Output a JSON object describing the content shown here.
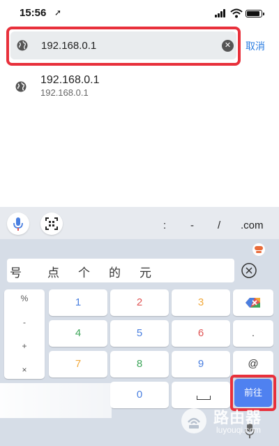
{
  "status": {
    "time": "15:56",
    "location_glyph": "➚"
  },
  "address_bar": {
    "url": "192.168.0.1",
    "cancel_label": "取消",
    "clear_glyph": "✕"
  },
  "suggestion": {
    "title": "192.168.0.1",
    "subtitle": "192.168.0.1"
  },
  "keyboard": {
    "quick_keys": [
      ":",
      "-",
      "/",
      ".com"
    ],
    "candidates": [
      "号",
      "点",
      "个",
      "的",
      "元"
    ],
    "symbols": [
      "%",
      "-",
      "+",
      "×"
    ],
    "rows": [
      [
        "1",
        "2",
        "3"
      ],
      [
        "4",
        "5",
        "6"
      ],
      [
        "7",
        "8",
        "9"
      ]
    ],
    "right_col": [
      "",
      ".",
      "@"
    ],
    "zero_key": "0",
    "go_label": "前往",
    "digit_colors": {
      "1": "#4a7fe0",
      "2": "#e05555",
      "3": "#f2a93b",
      "4": "#3ea65a",
      "5": "#4a7fe0",
      "6": "#e05555",
      "7": "#f2a93b",
      "8": "#3ea65a",
      "9": "#4a7fe0",
      "0": "#4a7fe0"
    }
  },
  "watermark": {
    "title": "路由器",
    "subtitle": "luyouqi.com"
  },
  "colors": {
    "highlight": "#e8303b",
    "accent": "#2a7de1",
    "go_key": "#4f81f0"
  }
}
